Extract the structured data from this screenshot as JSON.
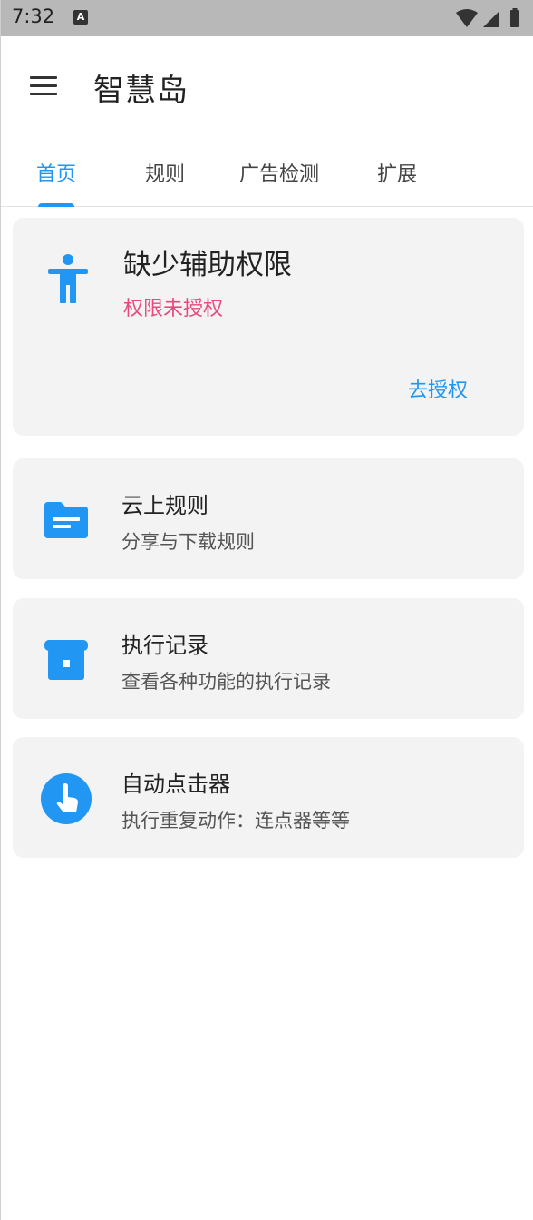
{
  "status_bar": {
    "time": "7:32",
    "notification_letter": "A"
  },
  "app_bar": {
    "title": "智慧岛",
    "menu_icon": "hamburger-menu-icon"
  },
  "tabs": [
    {
      "label": "首页",
      "active": true
    },
    {
      "label": "规则",
      "active": false
    },
    {
      "label": "广告检测",
      "active": false
    },
    {
      "label": "扩展",
      "active": false
    }
  ],
  "accessibility_card": {
    "icon": "accessibility-icon",
    "title": "缺少辅助权限",
    "status": "权限未授权",
    "action_label": "去授权"
  },
  "feature_cards": [
    {
      "icon": "folder-icon",
      "title": "云上规则",
      "subtitle": "分享与下载规则"
    },
    {
      "icon": "archive-icon",
      "title": "执行记录",
      "subtitle": "查看各种功能的执行记录"
    },
    {
      "icon": "touch-icon",
      "title": "自动点击器",
      "subtitle": "执行重复动作：连点器等等"
    }
  ],
  "colors": {
    "accent": "#2196f3",
    "warning_text": "#e84a7f",
    "card_background": "#f3f3f3",
    "status_bar": "#b8b8b8"
  }
}
